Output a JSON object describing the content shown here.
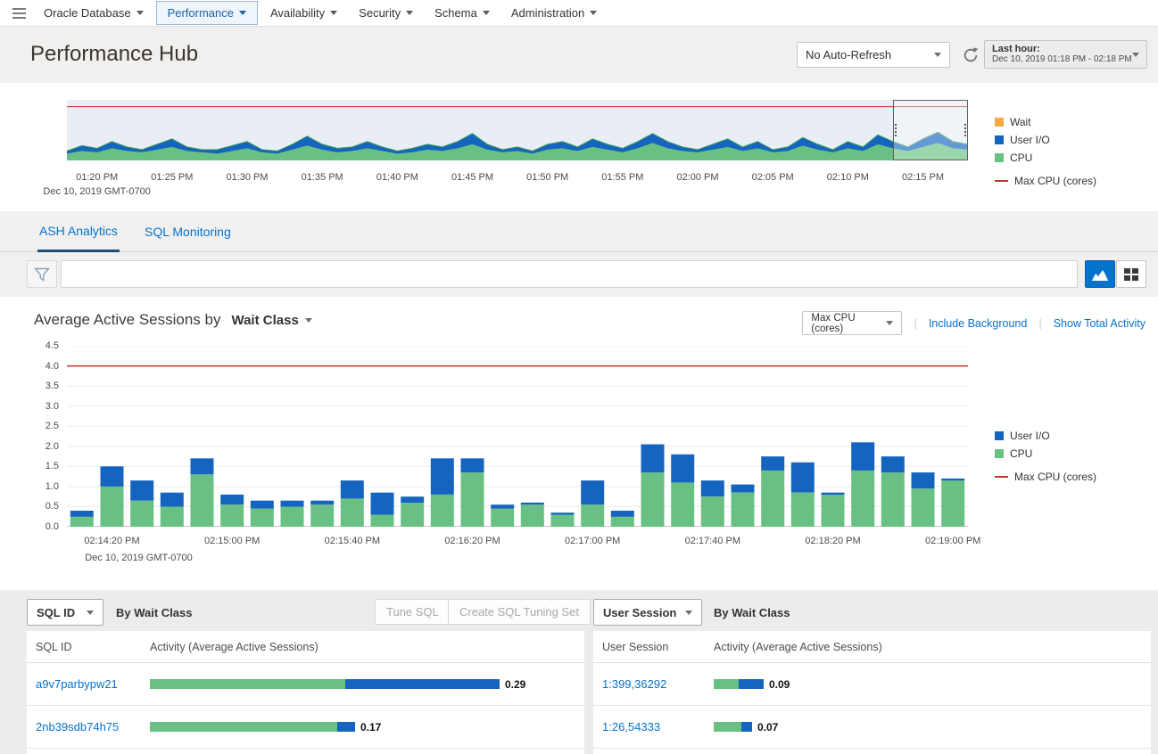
{
  "colors": {
    "accent_blue": "#0572ce",
    "cpu_green": "#68c182",
    "io_blue": "#1565c0",
    "wait_orange": "#f5aa46",
    "max_cpu_red": "#c0362c",
    "cpu_edge_green": "#3f9e58"
  },
  "nav": {
    "items": [
      {
        "label": "Oracle Database",
        "selected": false
      },
      {
        "label": "Performance",
        "selected": true
      },
      {
        "label": "Availability",
        "selected": false
      },
      {
        "label": "Security",
        "selected": false
      },
      {
        "label": "Schema",
        "selected": false
      },
      {
        "label": "Administration",
        "selected": false
      }
    ]
  },
  "header": {
    "title": "Performance Hub",
    "auto_refresh_value": "No Auto-Refresh",
    "time_range_label": "Last hour:",
    "time_range_value": "Dec 10, 2019 01:18 PM - 02:18 PM"
  },
  "tabs": [
    {
      "label": "ASH Analytics",
      "active": true
    },
    {
      "label": "SQL Monitoring",
      "active": false
    }
  ],
  "filter": {
    "input_value": ""
  },
  "aas": {
    "title_prefix": "Average Active Sessions by",
    "dimension": "Wait Class",
    "overlay_select_value": "Max CPU (cores)",
    "link_include_background": "Include Background",
    "link_show_total_activity": "Show Total Activity"
  },
  "chart_data": [
    {
      "id": "timeline-overview",
      "type": "area",
      "stacked": true,
      "ylim": [
        0,
        4.5
      ],
      "x_range_min": 60,
      "x_first_label_offset_min": 2,
      "x_label_interval_min": 5,
      "x_labels": [
        "01:20 PM",
        "01:25 PM",
        "01:30 PM",
        "01:35 PM",
        "01:40 PM",
        "01:45 PM",
        "01:50 PM",
        "01:55 PM",
        "02:00 PM",
        "02:05 PM",
        "02:10 PM",
        "02:15 PM"
      ],
      "x_sub_label": "Dec 10, 2019 GMT-0700",
      "series": [
        {
          "name": "CPU",
          "values": [
            0.5,
            0.7,
            0.6,
            0.9,
            0.7,
            0.6,
            0.8,
            1.0,
            0.7,
            0.6,
            0.5,
            0.7,
            0.9,
            0.6,
            0.5,
            0.8,
            1.1,
            0.8,
            0.6,
            0.7,
            0.9,
            0.7,
            0.5,
            0.6,
            0.8,
            0.7,
            0.9,
            1.2,
            0.8,
            0.6,
            0.7,
            0.5,
            0.8,
            0.9,
            0.7,
            1.0,
            0.8,
            0.6,
            0.9,
            1.3,
            0.9,
            0.7,
            0.6,
            0.8,
            1.0,
            0.7,
            0.9,
            0.6,
            0.7,
            1.1,
            0.8,
            0.6,
            0.9,
            0.7,
            1.2,
            0.9,
            0.7,
            1.0,
            1.3,
            0.9,
            0.8
          ]
        },
        {
          "name": "User I/O",
          "values": [
            0.2,
            0.4,
            0.3,
            0.5,
            0.3,
            0.2,
            0.4,
            0.6,
            0.3,
            0.2,
            0.3,
            0.4,
            0.5,
            0.2,
            0.2,
            0.4,
            0.7,
            0.4,
            0.3,
            0.3,
            0.5,
            0.3,
            0.2,
            0.3,
            0.4,
            0.3,
            0.5,
            0.8,
            0.4,
            0.2,
            0.3,
            0.2,
            0.4,
            0.5,
            0.3,
            0.6,
            0.4,
            0.3,
            0.5,
            0.7,
            0.5,
            0.3,
            0.2,
            0.4,
            0.6,
            0.3,
            0.5,
            0.2,
            0.3,
            0.6,
            0.4,
            0.2,
            0.5,
            0.3,
            0.7,
            0.5,
            0.3,
            0.6,
            0.8,
            0.5,
            0.4
          ]
        }
      ],
      "overlay_line": {
        "name": "Max CPU (cores)",
        "value": 4
      },
      "selection_window": {
        "start_min": 55,
        "end_min": 60
      },
      "legend": [
        {
          "label": "Wait",
          "color": "#f5aa46",
          "swatch": "square"
        },
        {
          "label": "User I/O",
          "color": "#1565c0",
          "swatch": "square"
        },
        {
          "label": "CPU",
          "color": "#68c182",
          "swatch": "square"
        },
        {
          "label": "Max CPU (cores)",
          "color": "#c0362c",
          "swatch": "line"
        }
      ]
    },
    {
      "id": "average-active-sessions",
      "type": "bar",
      "stacked": true,
      "ylim": [
        0,
        4.5
      ],
      "y_ticks": [
        "4.5",
        "4.0",
        "3.5",
        "3.0",
        "2.5",
        "2.0",
        "1.5",
        "1.0",
        "0.5",
        "0.0"
      ],
      "x_labels": [
        "02:14:20 PM",
        "02:15:00 PM",
        "02:15:40 PM",
        "02:16:20 PM",
        "02:17:00 PM",
        "02:17:40 PM",
        "02:18:20 PM",
        "02:19:00 PM"
      ],
      "x_label_start_bar_index": 1,
      "x_label_every_n_bars": 4,
      "x_sub_label": "Dec 10, 2019 GMT-0700",
      "series": [
        {
          "name": "CPU",
          "color": "#68c182",
          "values": [
            0.25,
            1.0,
            0.65,
            0.5,
            1.3,
            0.55,
            0.45,
            0.5,
            0.55,
            0.7,
            0.3,
            0.6,
            0.8,
            1.35,
            0.45,
            0.55,
            0.3,
            0.55,
            0.25,
            1.35,
            1.1,
            0.75,
            0.85,
            1.4,
            0.85,
            0.8,
            1.4,
            1.35,
            0.95,
            1.15
          ]
        },
        {
          "name": "User I/O",
          "color": "#1565c0",
          "values": [
            0.15,
            0.5,
            0.5,
            0.35,
            0.4,
            0.25,
            0.2,
            0.15,
            0.1,
            0.45,
            0.55,
            0.15,
            0.9,
            0.35,
            0.1,
            0.05,
            0.05,
            0.6,
            0.15,
            0.7,
            0.7,
            0.4,
            0.2,
            0.35,
            0.75,
            0.05,
            0.7,
            0.4,
            0.4,
            0.05
          ]
        }
      ],
      "overlay_line": {
        "name": "Max CPU (cores)",
        "value": 4
      },
      "legend": [
        {
          "label": "User I/O",
          "color": "#1565c0",
          "swatch": "square"
        },
        {
          "label": "CPU",
          "color": "#68c182",
          "swatch": "square"
        },
        {
          "label": "Max CPU (cores)",
          "color": "#c0362c",
          "swatch": "line"
        }
      ]
    }
  ],
  "sql_panel": {
    "selector_value": "SQL ID",
    "subtitle": "By Wait Class",
    "buttons": [
      {
        "label": "Tune SQL",
        "enabled": false
      },
      {
        "label": "Create SQL Tuning Set",
        "enabled": false
      }
    ],
    "columns": [
      "SQL ID",
      "Activity (Average Active Sessions)"
    ],
    "rows": [
      {
        "id": "a9v7parbypw21",
        "activity": {
          "cpu": 0.162,
          "io": 0.128
        },
        "value": "0.29"
      },
      {
        "id": "2nb39sdb74h75",
        "activity": {
          "cpu": 0.155,
          "io": 0.015
        },
        "value": "0.17"
      }
    ]
  },
  "session_panel": {
    "selector_value": "User Session",
    "subtitle": "By Wait Class",
    "columns": [
      "User Session",
      "Activity (Average Active Sessions)"
    ],
    "rows": [
      {
        "id": "1:399,36292",
        "activity": {
          "cpu": 0.045,
          "io": 0.045
        },
        "value": "0.09"
      },
      {
        "id": "1:26,54333",
        "activity": {
          "cpu": 0.05,
          "io": 0.02
        },
        "value": "0.07"
      }
    ]
  }
}
